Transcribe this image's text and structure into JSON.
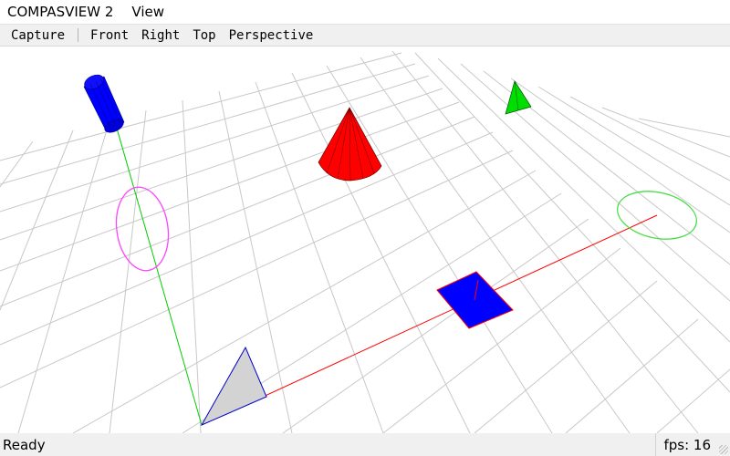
{
  "menubar": {
    "app_title": "COMPASVIEW 2",
    "view_menu": "View"
  },
  "toolbar": {
    "capture": "Capture",
    "front": "Front",
    "right": "Right",
    "top": "Top",
    "perspective": "Perspective"
  },
  "statusbar": {
    "status": "Ready",
    "fps_label": "fps: 16"
  },
  "colors": {
    "grid": "#c8c8c8",
    "x_axis": "#ff0000",
    "y_axis": "#00cc00",
    "cylinder": "#0000ff",
    "cone": "#ff0000",
    "square": "#0000ff",
    "triangle_fill": "#d3d3d3",
    "small_cone": "#00dd00",
    "circle_magenta": "#ff44ff",
    "circle_green": "#44dd44"
  },
  "scene_objects": [
    "grid",
    "x-axis",
    "y-axis",
    "cylinder",
    "cone",
    "square",
    "triangle",
    "small-cone",
    "magenta-circle",
    "green-circle"
  ]
}
